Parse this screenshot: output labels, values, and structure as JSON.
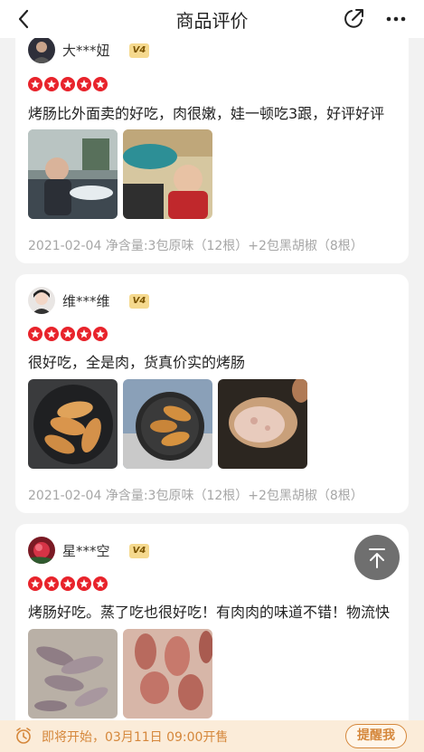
{
  "header": {
    "title": "商品评价"
  },
  "reviews": [
    {
      "user": "大***妞",
      "vip": "V4",
      "rating": 5,
      "content": "烤肠比外面卖的好吃，肉很嫩，娃一顿吃3跟，好评好评",
      "date": "2021-02-04",
      "spec": "净含量:3包原味（12根）+2包黑胡椒（8根）"
    },
    {
      "user": "维***维",
      "vip": "V4",
      "rating": 5,
      "content": "很好吃，全是肉，货真价实的烤肠",
      "date": "2021-02-04",
      "spec": "净含量:3包原味（12根）+2包黑胡椒（8根）"
    },
    {
      "user": "星***空",
      "vip": "V4",
      "rating": 5,
      "content": "烤肠好吃。蒸了吃也很好吃！有肉肉的味道不错！物流快"
    }
  ],
  "bottom_bar": {
    "notice": "即将开始，03月11日 09:00开售",
    "remind_label": "提醒我"
  },
  "colors": {
    "star": "#e8232b",
    "accent": "#d5873b"
  }
}
